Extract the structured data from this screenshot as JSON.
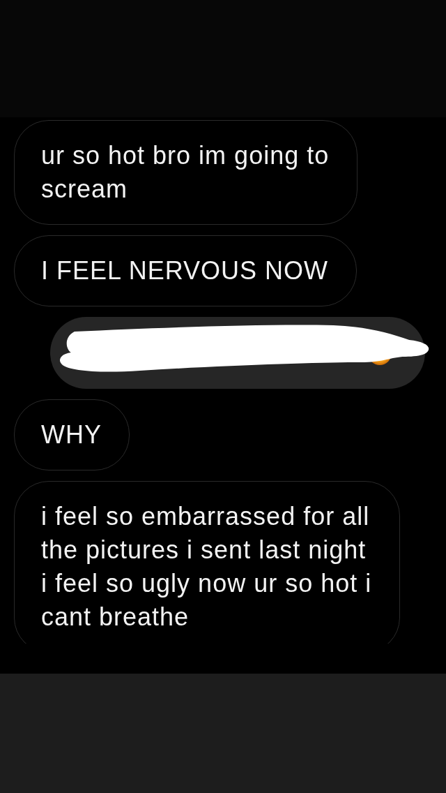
{
  "messages": [
    {
      "kind": "received",
      "text": "ur so hot bro im going to scream"
    },
    {
      "kind": "received",
      "text": "I FEEL NERVOUS NOW"
    },
    {
      "kind": "redacted_sent"
    },
    {
      "kind": "received",
      "text": "WHY"
    },
    {
      "kind": "received",
      "text": "i feel so embarrassed for all the pictures i sent last night i feel so ugly now ur so hot i cant breathe"
    }
  ]
}
